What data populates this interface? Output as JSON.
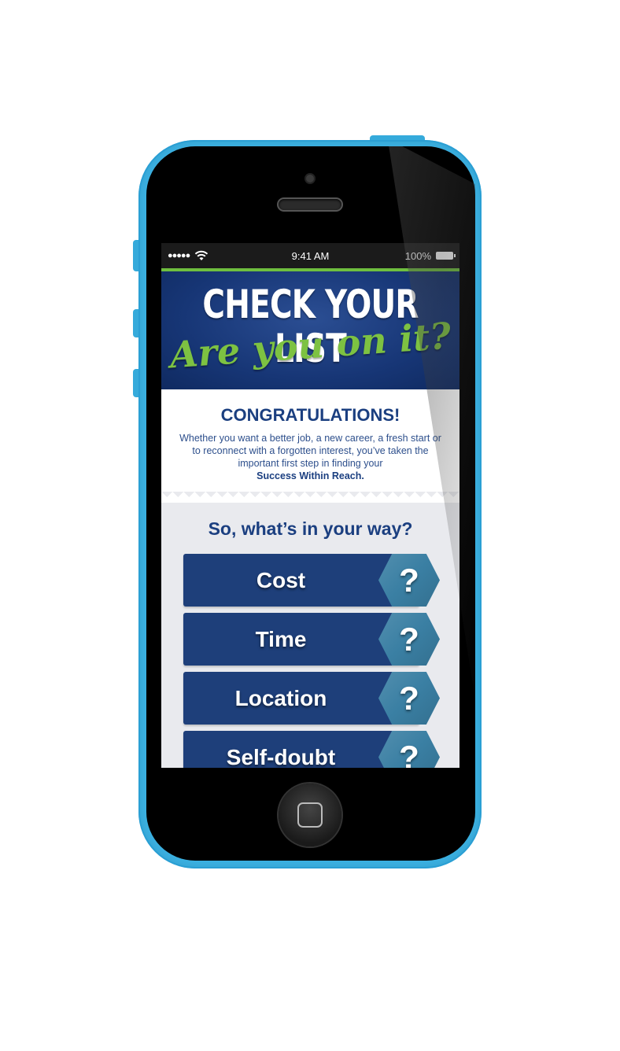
{
  "status_bar": {
    "signal": "●●●●●",
    "wifi_icon": "wifi-icon",
    "time": "9:41 AM",
    "battery": "100%"
  },
  "banner": {
    "title": "CHECK YOUR LIST",
    "subtitle": "Are you on it?"
  },
  "congrats": {
    "title": "CONGRATULATIONS!",
    "body": "Whether you want a better job, a new career, a fresh start or to reconnect with a forgotten interest, you’ve taken the important first step in finding your",
    "emphasis": "Success Within Reach."
  },
  "obstacles": {
    "title": "So, what’s in your way?",
    "items": [
      {
        "label": "Cost",
        "badge": "?"
      },
      {
        "label": "Time",
        "badge": "?"
      },
      {
        "label": "Location",
        "badge": "?"
      },
      {
        "label": "Self-doubt",
        "badge": "?"
      }
    ]
  },
  "colors": {
    "phone_body": "#3cb4e6",
    "navy": "#1e3f7a",
    "accent_green": "#7dc242",
    "hex_teal": "#3a7fa3"
  }
}
